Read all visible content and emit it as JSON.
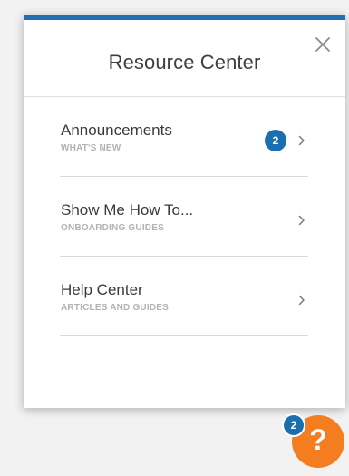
{
  "panel": {
    "title": "Resource Center",
    "accent_color": "#1f6fb5",
    "close_icon": "close-icon"
  },
  "items": [
    {
      "title": "Announcements",
      "subtitle": "WHAT'S NEW",
      "badge": "2",
      "icon": "chevron-right-icon"
    },
    {
      "title": "Show Me How To...",
      "subtitle": "ONBOARDING GUIDES",
      "icon": "chevron-right-icon"
    },
    {
      "title": "Help Center",
      "subtitle": "ARTICLES AND GUIDES",
      "icon": "chevron-right-icon"
    }
  ],
  "launcher": {
    "label": "?",
    "badge": "2",
    "color": "#f47d20",
    "badge_color": "#1a6fb0"
  }
}
